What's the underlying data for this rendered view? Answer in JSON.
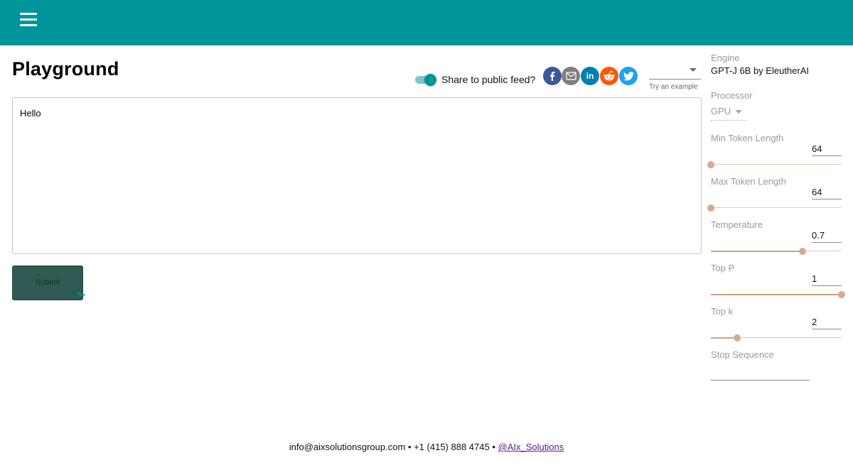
{
  "header": {
    "menu_icon": "hamburger-menu-icon",
    "background_color": "#00959b"
  },
  "page": {
    "title": "Playground"
  },
  "share": {
    "label": "Share to public feed?",
    "enabled": true
  },
  "social": [
    {
      "name": "facebook",
      "icon": "facebook-icon",
      "color": "#3b5998"
    },
    {
      "name": "email",
      "icon": "email-icon",
      "color": "#7f7f7f"
    },
    {
      "name": "linkedin",
      "icon": "linkedin-icon",
      "color": "#007fb1",
      "text": "in"
    },
    {
      "name": "reddit",
      "icon": "reddit-icon",
      "color": "#ff5700"
    },
    {
      "name": "twitter",
      "icon": "twitter-icon",
      "color": "#1da1f2"
    }
  ],
  "example": {
    "selected": "",
    "hint": "Try an example"
  },
  "prompt": {
    "value": "Hello"
  },
  "submit": {
    "label": "Submit",
    "color": "#2f5a54"
  },
  "settings": {
    "engine": {
      "label": "Engine",
      "value": "GPT-J 6B by EleutherAI"
    },
    "processor": {
      "label": "Processor",
      "value": "GPU"
    },
    "min_tokens": {
      "label": "Min Token Length",
      "value": "64",
      "fraction": 0.0
    },
    "max_tokens": {
      "label": "Max Token Length",
      "value": "64",
      "fraction": 0.0
    },
    "temperature": {
      "label": "Temperature",
      "value": "0.7",
      "fraction": 0.7
    },
    "top_p": {
      "label": "Top P",
      "value": "1",
      "fraction": 1.0
    },
    "top_k": {
      "label": "Top k",
      "value": "2",
      "fraction": 0.2
    },
    "stop_sequence": {
      "label": "Stop Sequence",
      "value": ""
    },
    "slider_color": "#d8a98b"
  },
  "footer": {
    "email": "info@aixsolutionsgroup.com",
    "separator": "•",
    "phone": "+1 (415) 888 4745",
    "twitter_handle": "@AIx_Solutions"
  }
}
